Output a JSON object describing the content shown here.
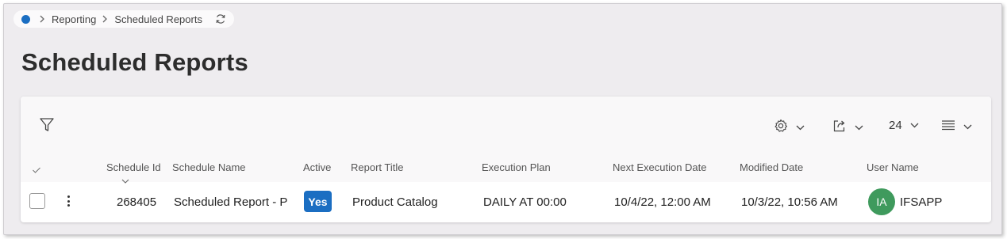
{
  "breadcrumb": {
    "items": [
      "Reporting",
      "Scheduled Reports"
    ]
  },
  "page": {
    "title": "Scheduled Reports"
  },
  "toolbar": {
    "page_size": "24"
  },
  "table": {
    "columns": [
      "Schedule Id",
      "Schedule Name",
      "Active",
      "Report Title",
      "Execution Plan",
      "Next Execution Date",
      "Modified Date",
      "User Name"
    ],
    "rows": [
      {
        "schedule_id": "268405",
        "schedule_name": "Scheduled Report - P",
        "active": "Yes",
        "report_title": "Product Catalog",
        "execution_plan": "DAILY AT 00:00",
        "next_execution_date": "10/4/22, 12:00 AM",
        "modified_date": "10/3/22, 10:56 AM",
        "user_initials": "IA",
        "user_name": "IFSAPP"
      }
    ]
  },
  "colors": {
    "accent": "#1b6ec2",
    "avatar": "#3f9a5d"
  }
}
